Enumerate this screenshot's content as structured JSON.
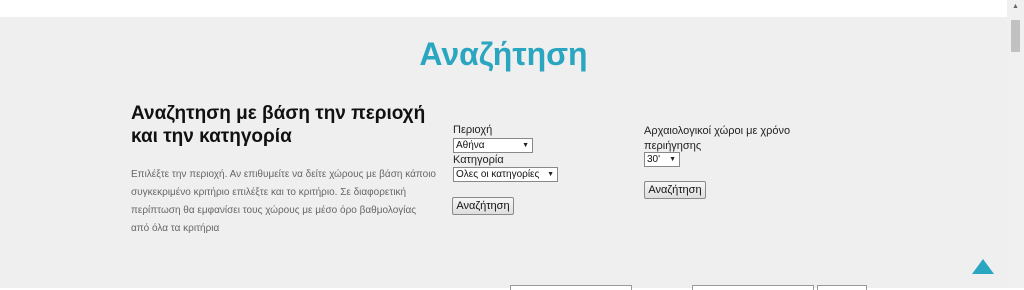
{
  "page": {
    "title": "Αναζήτηση"
  },
  "intro": {
    "heading": "Αναζητηση με βάση την περιοχή και την κατηγορία",
    "help": "Επιλέξτε την περιοχή. Αν επιθυμείτε να δείτε χώρους με βάση κάποιο συγκεκριμένο κριτήριο επιλέξτε και το κριτήριο. Σε διαφορετική περίπτωση θα εμφανίσει τους χώρους με μέσο όρο βαθμολογίας από όλα τα κριτήρια"
  },
  "form_region": {
    "region_label": "Περιοχή",
    "region_value": "Αθήνα",
    "category_label": "Κατηγορία",
    "category_value": "Ολες οι κατηγορίες",
    "search_button": "Αναζήτηση"
  },
  "form_time": {
    "label": "Αρχαιολογικοί χώροι με χρόνο περιήγησης",
    "duration_value": "30'",
    "search_button": "Αναζήτηση"
  },
  "icons": {
    "select_arrow": "▼",
    "scroll_up": "▲"
  },
  "colors": {
    "accent": "#2aa6c1",
    "panel_background": "#efefef"
  }
}
